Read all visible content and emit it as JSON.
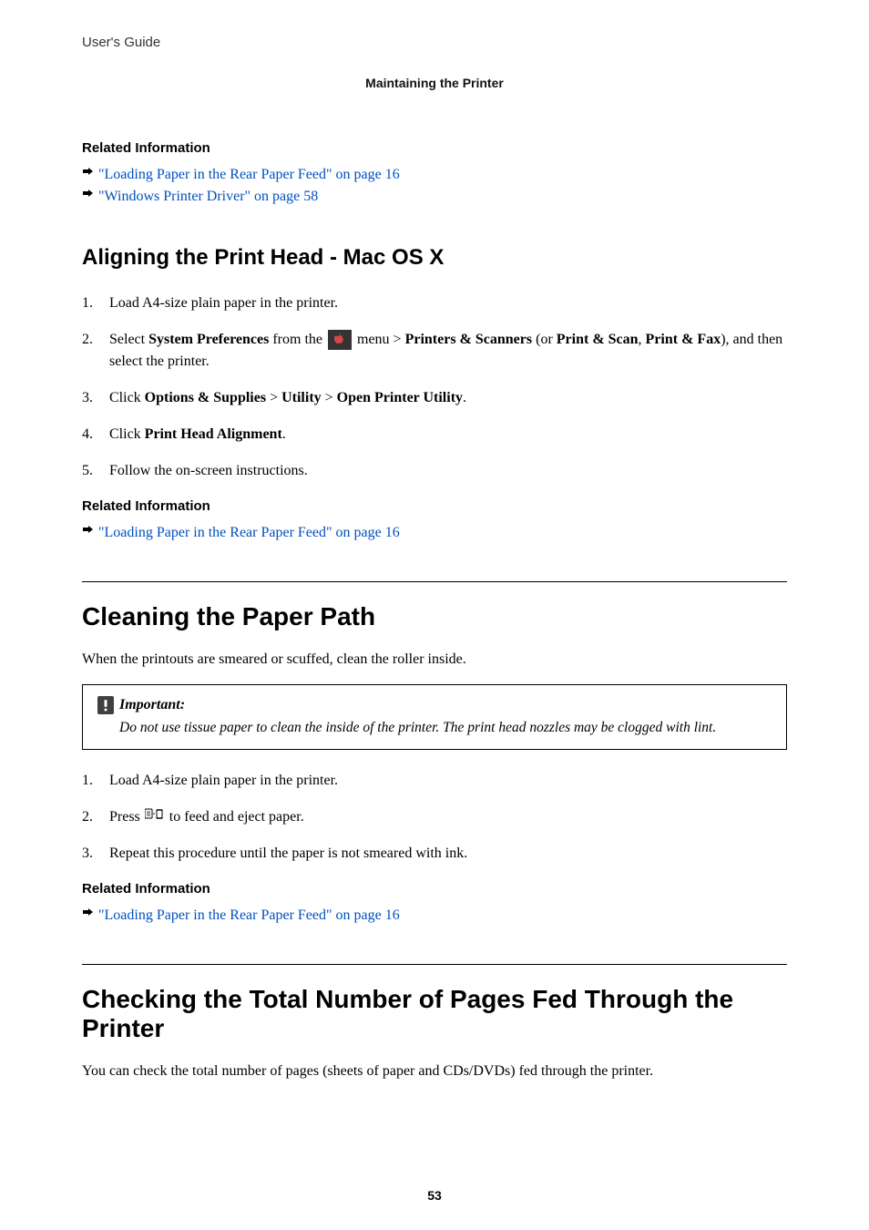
{
  "header": {
    "guide_label": "User's Guide",
    "section": "Maintaining the Printer"
  },
  "related1": {
    "heading": "Related Information",
    "links": [
      "\"Loading Paper in the Rear Paper Feed\" on page 16",
      "\"Windows Printer Driver\" on page 58"
    ]
  },
  "section_mac": {
    "title": "Aligning the Print Head - Mac OS X",
    "step1_num": "1.",
    "step1_text": "Load A4-size plain paper in the printer.",
    "step2_num": "2.",
    "step2_pre": "Select ",
    "step2_bold1": "System Preferences",
    "step2_mid1": " from the ",
    "step2_mid2": " menu > ",
    "step2_bold2": "Printers & Scanners",
    "step2_mid3": " (or ",
    "step2_bold3": "Print & Scan",
    "step2_mid4": ", ",
    "step2_bold4": "Print & Fax",
    "step2_mid5": "), and then select the printer.",
    "step3_num": "3.",
    "step3_pre": "Click ",
    "step3_bold1": "Options & Supplies",
    "step3_mid1": " > ",
    "step3_bold2": "Utility",
    "step3_mid2": " > ",
    "step3_bold3": "Open Printer Utility",
    "step3_post": ".",
    "step4_num": "4.",
    "step4_pre": "Click ",
    "step4_bold1": "Print Head Alignment",
    "step4_post": ".",
    "step5_num": "5.",
    "step5_text": "Follow the on-screen instructions."
  },
  "related2": {
    "heading": "Related Information",
    "links": [
      "\"Loading Paper in the Rear Paper Feed\" on page 16"
    ]
  },
  "section_cleaning": {
    "title": "Cleaning the Paper Path",
    "intro": "When the printouts are smeared or scuffed, clean the roller inside.",
    "important_label": "Important:",
    "important_text": "Do not use tissue paper to clean the inside of the printer. The print head nozzles may be clogged with lint.",
    "step1_num": "1.",
    "step1_text": "Load A4-size plain paper in the printer.",
    "step2_num": "2.",
    "step2_pre": "Press ",
    "step2_post": " to feed and eject paper.",
    "step3_num": "3.",
    "step3_text": "Repeat this procedure until the paper is not smeared with ink."
  },
  "related3": {
    "heading": "Related Information",
    "links": [
      "\"Loading Paper in the Rear Paper Feed\" on page 16"
    ]
  },
  "section_checking": {
    "title": "Checking the Total Number of Pages Fed Through the Printer",
    "intro": "You can check the total number of pages (sheets of paper and CDs/DVDs) fed through the printer."
  },
  "page_number": "53"
}
